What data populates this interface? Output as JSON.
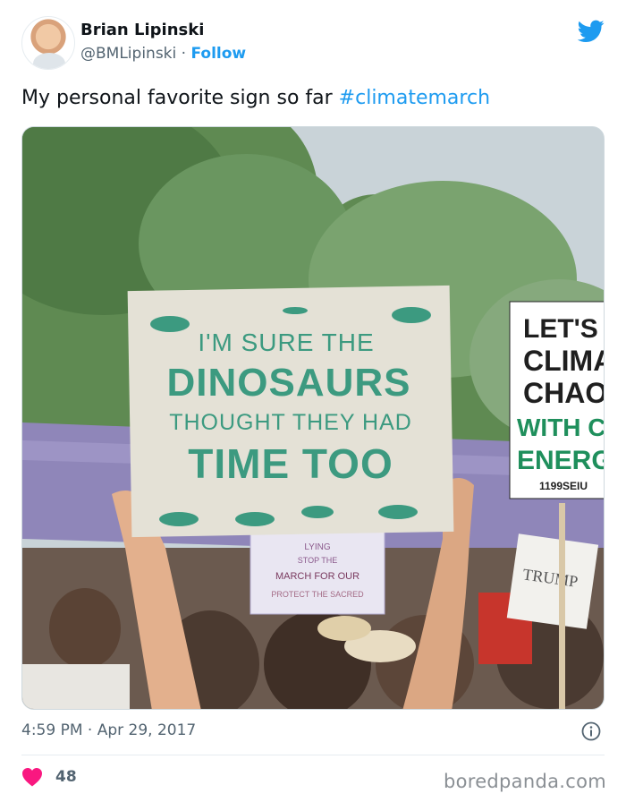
{
  "author": {
    "name": "Brian Lipinski",
    "handle": "@BMLipinski",
    "separator": "·",
    "follow_label": "Follow"
  },
  "tweet": {
    "text": "My personal favorite sign so far ",
    "hashtag": "#climatemarch"
  },
  "photo": {
    "main_sign": {
      "line1": "I'M SURE THE",
      "line2": "DINOSAURS",
      "line3": "THOUGHT THEY HAD",
      "line4": "TIME TOO"
    },
    "right_sign": {
      "lines": [
        "LET'S SO",
        "CLIMA",
        "CHAO",
        "WITH CLE",
        "ENERG"
      ],
      "footer": "1199SEIU"
    },
    "small_sign": {
      "lines": [
        "LYING",
        "STOP THE",
        "MARCH FOR OUR",
        "PROTECT THE SACRED"
      ]
    },
    "trump_sign": "TRUMP",
    "colors": {
      "sky": "#c9d3d8",
      "trees": "#5f8a52",
      "sign_board": "#e4e1d6",
      "sign_text": "#3c9a80",
      "banner": "#8f86b9"
    }
  },
  "meta": {
    "time": "4:59 PM",
    "separator": "·",
    "date": "Apr 29, 2017",
    "likes": "48",
    "like_color": "#f91880",
    "brand_color": "#1d9bf0"
  },
  "watermark": "boredpanda.com"
}
